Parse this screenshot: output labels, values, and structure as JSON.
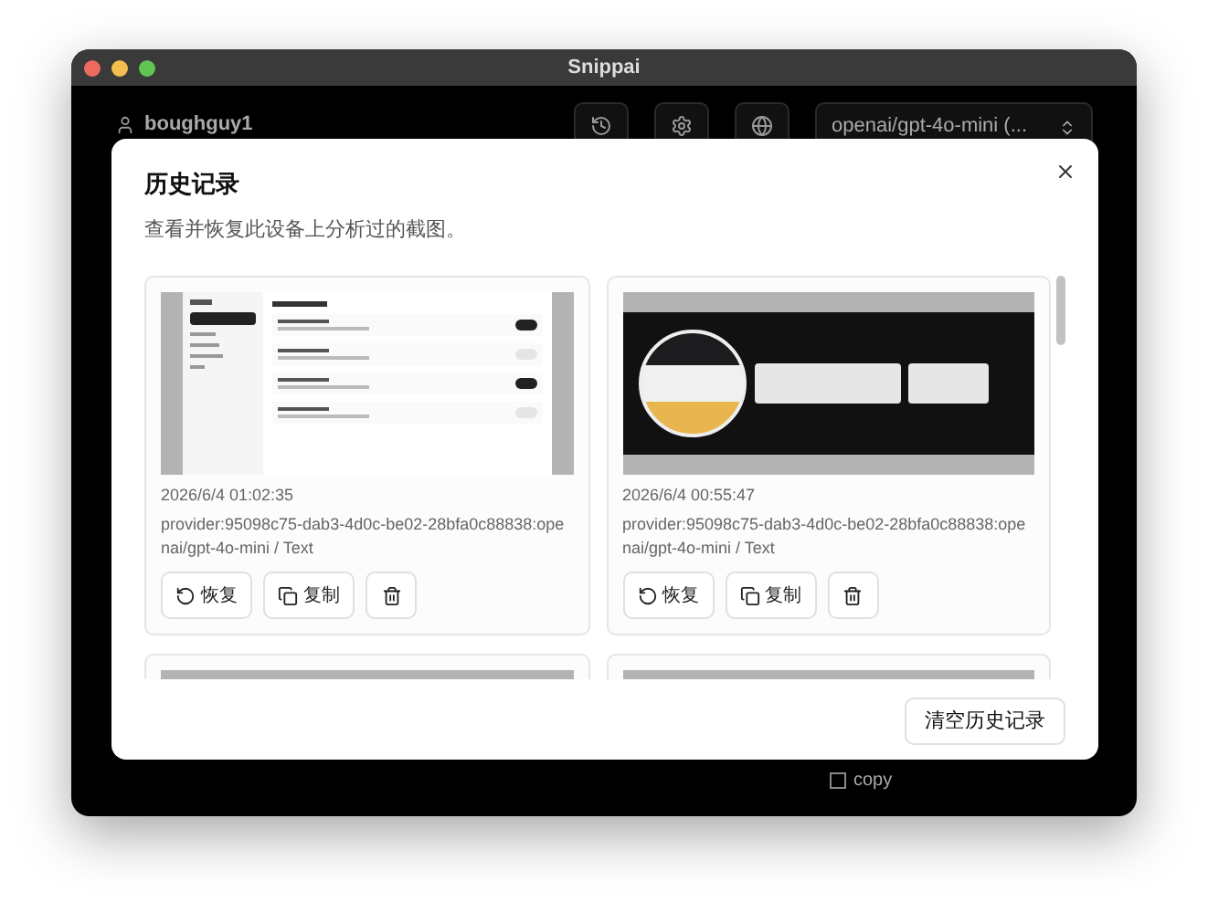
{
  "window": {
    "title": "Snippai"
  },
  "app": {
    "user": "boughguy1",
    "model_select": "openai/gpt-4o-mini (...",
    "copy_option": {
      "label": "copy",
      "checked": false
    }
  },
  "dialog": {
    "title": "历史记录",
    "description": "查看并恢复此设备上分析过的截图。",
    "entries": [
      {
        "kind": "settings_window",
        "timestamp": "2026/6/4 01:02:35",
        "meta": "provider:95098c75-dab3-4d0c-be02-28bfa0c88838:openai/gpt-4o-mini / Text",
        "restore_label": "恢复",
        "copy_label": "复制"
      },
      {
        "kind": "logo",
        "timestamp": "2026/6/4 00:55:47",
        "meta": "provider:95098c75-dab3-4d0c-be02-28bfa0c88838:openai/gpt-4o-mini / Text",
        "restore_label": "恢复",
        "copy_label": "复制"
      },
      {
        "kind": "partial_window"
      },
      {
        "kind": "gray"
      }
    ],
    "clear_button": "清空历史记录"
  }
}
